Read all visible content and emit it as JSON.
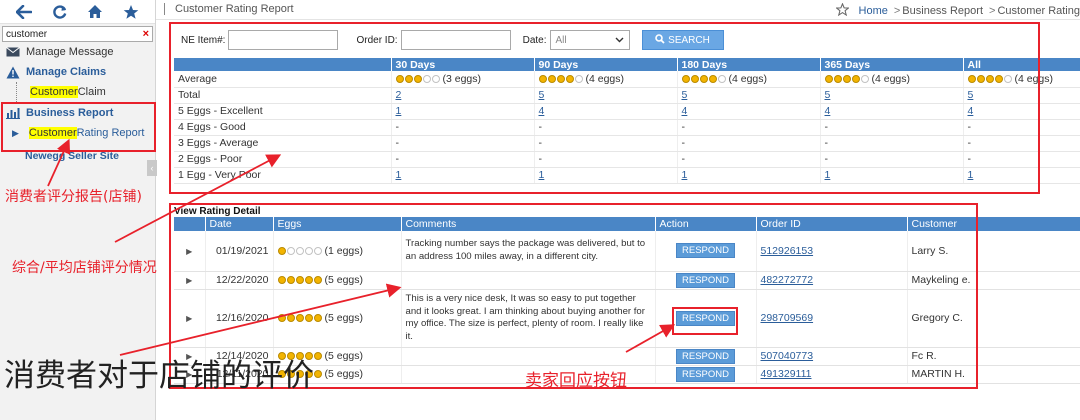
{
  "sidebar": {
    "search_value": "customer",
    "clear_glyph": "×",
    "items": [
      {
        "label": "Manage Message"
      },
      {
        "label": "Manage Claims"
      },
      {
        "label_hl": "Customer",
        "label_rest": " Claim"
      },
      {
        "label": "Business Report"
      },
      {
        "label_hl": "Customer",
        "label_rest": " Rating Report"
      },
      {
        "label": "Newegg Seller Site"
      }
    ],
    "collapse_glyph": "‹"
  },
  "header": {
    "title": "Customer Rating Report",
    "breadcrumb": {
      "home": "Home",
      "level1": "Business Report",
      "level2": "Customer Rating"
    }
  },
  "filters": {
    "ne_item_label": "NE Item#:",
    "order_id_label": "Order ID:",
    "date_label": "Date:",
    "date_value": "All",
    "search_label": "SEARCH"
  },
  "summary": {
    "columns": [
      "",
      "30 Days",
      "90 Days",
      "180 Days",
      "365 Days",
      "All"
    ],
    "rows": [
      {
        "label": "Average",
        "cells": [
          {
            "eggs": 3,
            "text": "(3 eggs)"
          },
          {
            "eggs": 4,
            "text": "(4 eggs)"
          },
          {
            "eggs": 4,
            "text": "(4 eggs)"
          },
          {
            "eggs": 4,
            "text": "(4 eggs)"
          },
          {
            "eggs": 4,
            "text": "(4 eggs)"
          }
        ]
      },
      {
        "label": "Total",
        "cells": [
          "2",
          "5",
          "5",
          "5",
          "5"
        ],
        "link": true
      },
      {
        "label": "5 Eggs - Excellent",
        "cells": [
          "1",
          "4",
          "4",
          "4",
          "4"
        ],
        "link": true
      },
      {
        "label": "4 Eggs - Good",
        "cells": [
          "-",
          "-",
          "-",
          "-",
          "-"
        ]
      },
      {
        "label": "3 Eggs - Average",
        "cells": [
          "-",
          "-",
          "-",
          "-",
          "-"
        ]
      },
      {
        "label": "2 Eggs - Poor",
        "cells": [
          "-",
          "-",
          "-",
          "-",
          "-"
        ]
      },
      {
        "label": "1 Egg - Very Poor",
        "cells": [
          "1",
          "1",
          "1",
          "1",
          "1"
        ],
        "link": true
      }
    ]
  },
  "detail": {
    "title": "View Rating Detail",
    "columns": [
      "",
      "Date",
      "Eggs",
      "Comments",
      "Action",
      "Order ID",
      "Customer"
    ],
    "respond_label": "RESPOND",
    "rows": [
      {
        "date": "01/19/2021",
        "eggs": 1,
        "eggs_text": "(1 eggs)",
        "comment": "Tracking number says the package was delivered, but to an address 100 miles away, in a different city.",
        "order_id": "512926153",
        "customer": "Larry S."
      },
      {
        "date": "12/22/2020",
        "eggs": 5,
        "eggs_text": "(5 eggs)",
        "comment": "",
        "order_id": "482272772",
        "customer": "Maykeling e."
      },
      {
        "date": "12/16/2020",
        "eggs": 5,
        "eggs_text": "(5 eggs)",
        "comment": "This is a very nice desk, It was so easy to put together and it looks great. I am thinking about buying another for my office. The size is perfect, plenty of room. I really like it.",
        "order_id": "298709569",
        "customer": "Gregory C."
      },
      {
        "date": "12/14/2020",
        "eggs": 5,
        "eggs_text": "(5 eggs)",
        "comment": "",
        "order_id": "507040773",
        "customer": "Fc R."
      },
      {
        "date": "12/11/2020",
        "eggs": 5,
        "eggs_text": "(5 eggs)",
        "comment": "",
        "order_id": "491329111",
        "customer": "MARTIN H."
      }
    ]
  },
  "annotations": {
    "report_label": "消费者评分报告(店铺)",
    "average_label": "综合/平均店铺评分情况",
    "reviews_label": "消费者对于店铺的评价",
    "respond_label": "卖家回应按钮"
  },
  "colors": {
    "accent": "#4a86c6",
    "annotation": "#e8212b",
    "highlight": "#ffff00",
    "egg": "#f3b400"
  }
}
